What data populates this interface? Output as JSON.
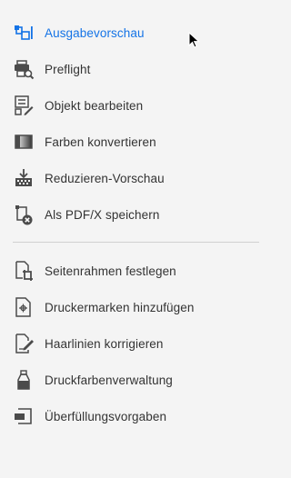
{
  "colors": {
    "background": "#f4f4f4",
    "text": "#333333",
    "active_text": "#1473e6",
    "icon": "#4b4b4b",
    "divider": "#d0d0d0"
  },
  "tools": [
    {
      "label": "Ausgabevorschau",
      "icon": "output-preview-icon",
      "active": true
    },
    {
      "label": "Preflight",
      "icon": "printer-magnifier-icon",
      "active": false
    },
    {
      "label": "Objekt bearbeiten",
      "icon": "edit-object-icon",
      "active": false
    },
    {
      "label": "Farben konvertieren",
      "icon": "gradient-swatch-icon",
      "active": false
    },
    {
      "label": "Reduzieren-Vorschau",
      "icon": "flatten-preview-icon",
      "active": false
    },
    {
      "label": "Als PDF/X speichern",
      "icon": "save-pdfx-icon",
      "active": false
    }
  ],
  "tools2": [
    {
      "label": "Seitenrahmen festlegen",
      "icon": "crop-pages-icon"
    },
    {
      "label": "Druckermarken hinzufügen",
      "icon": "printer-marks-icon"
    },
    {
      "label": "Haarlinien korrigieren",
      "icon": "fix-hairlines-icon"
    },
    {
      "label": "Druckfarbenverwaltung",
      "icon": "ink-manager-icon"
    },
    {
      "label": "Überfüllungsvorgaben",
      "icon": "trap-presets-icon"
    }
  ]
}
